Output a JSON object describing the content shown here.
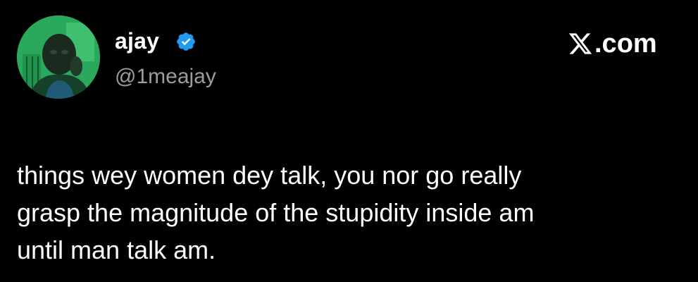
{
  "tweet": {
    "display_name": "ajay",
    "handle": "@1meajay",
    "brand": {
      "mark_icon": "x-logo-icon",
      "suffix": ".com"
    },
    "verified_icon": "verified-badge-icon",
    "avatar_icon": "profile-photo",
    "text_lines": [
      "things wey women dey talk, you nor go really",
      "grasp the magnitude of the stupidity inside am",
      "until man talk am."
    ]
  },
  "colors": {
    "background": "#000000",
    "text": "#ffffff",
    "handle": "#9a9ea3",
    "verified": "#1d9bf0",
    "avatar_bg": "#2fb765"
  }
}
